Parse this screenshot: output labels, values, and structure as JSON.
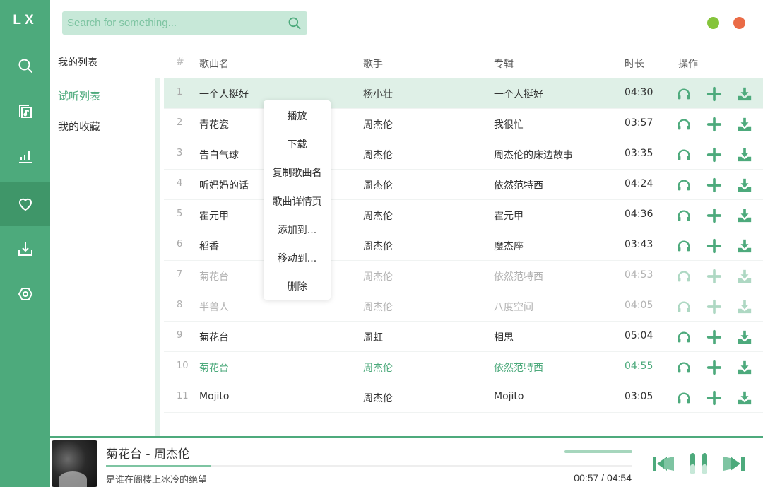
{
  "app": {
    "logo": "LX"
  },
  "colors": {
    "accent": "#4daa7c",
    "accent_dark": "#3f9669",
    "accent_light": "#c7e8d8",
    "min_button": "#85c43b",
    "close_button": "#ea6b46"
  },
  "sidebar": {
    "items": [
      {
        "icon": "search-icon",
        "active": false
      },
      {
        "icon": "music-list-icon",
        "active": false
      },
      {
        "icon": "chart-icon",
        "active": false
      },
      {
        "icon": "heart-icon",
        "active": true
      },
      {
        "icon": "download-icon",
        "active": false
      },
      {
        "icon": "settings-icon",
        "active": false
      }
    ]
  },
  "search": {
    "placeholder": "Search for something...",
    "value": ""
  },
  "lists": {
    "title": "我的列表",
    "items": [
      {
        "label": "试听列表",
        "active": true
      },
      {
        "label": "我的收藏",
        "active": false
      }
    ]
  },
  "table": {
    "headers": {
      "num": "#",
      "name": "歌曲名",
      "artist": "歌手",
      "album": "专辑",
      "duration": "时长",
      "actions": "操作"
    },
    "rows": [
      {
        "num": "1",
        "name": "一个人挺好",
        "artist": "杨小壮",
        "album": "一个人挺好",
        "duration": "04:30",
        "state": "selected"
      },
      {
        "num": "2",
        "name": "青花瓷",
        "artist": "周杰伦",
        "album": "我很忙",
        "duration": "03:57",
        "state": ""
      },
      {
        "num": "3",
        "name": "告白气球",
        "artist": "周杰伦",
        "album": "周杰伦的床边故事",
        "duration": "03:35",
        "state": ""
      },
      {
        "num": "4",
        "name": "听妈妈的话",
        "artist": "周杰伦",
        "album": "依然范特西",
        "duration": "04:24",
        "state": ""
      },
      {
        "num": "5",
        "name": "霍元甲",
        "artist": "周杰伦",
        "album": "霍元甲",
        "duration": "04:36",
        "state": ""
      },
      {
        "num": "6",
        "name": "稻香",
        "artist": "周杰伦",
        "album": "魔杰座",
        "duration": "03:43",
        "state": ""
      },
      {
        "num": "7",
        "name": "菊花台",
        "artist": "周杰伦",
        "album": "依然范特西",
        "duration": "04:53",
        "state": "disabled"
      },
      {
        "num": "8",
        "name": "半兽人",
        "artist": "周杰伦",
        "album": "八度空间",
        "duration": "04:05",
        "state": "disabled"
      },
      {
        "num": "9",
        "name": "菊花台",
        "artist": "周虹",
        "album": "相思",
        "duration": "05:04",
        "state": ""
      },
      {
        "num": "10",
        "name": "菊花台",
        "artist": "周杰伦",
        "album": "依然范特西",
        "duration": "04:55",
        "state": "playing"
      },
      {
        "num": "11",
        "name": "Mojito",
        "artist": "周杰伦",
        "album": "Mojito",
        "duration": "03:05",
        "state": ""
      }
    ],
    "row_actions": [
      "headphones-icon",
      "plus-icon",
      "download-icon"
    ]
  },
  "context_menu": {
    "items": [
      "播放",
      "下载",
      "复制歌曲名",
      "歌曲详情页",
      "添加到...",
      "移动到...",
      "删除"
    ]
  },
  "player": {
    "title": "菊花台 - 周杰伦",
    "lyric": "是谁在阁楼上冰冷的绝望",
    "current_time": "00:57",
    "total_time": "04:54",
    "time_display": "00:57 / 04:54",
    "progress_percent": 20,
    "volume_percent": 100
  }
}
